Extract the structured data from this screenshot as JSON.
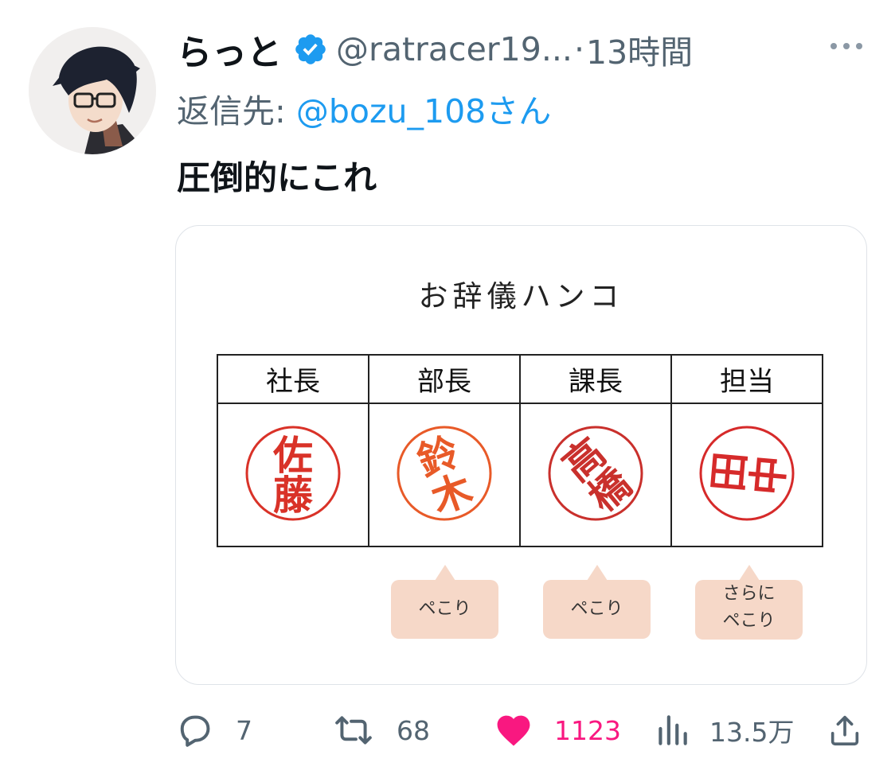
{
  "tweet": {
    "author_name": "らっと",
    "handle": "@ratracer19...",
    "separator": "·",
    "time": "13時間",
    "reply_label": "返信先:",
    "reply_mention": "@bozu_108さん",
    "text": "圧倒的にこれ"
  },
  "image": {
    "title": "お辞儀ハンコ",
    "columns": [
      "社長",
      "部長",
      "課長",
      "担当"
    ],
    "stamps": [
      {
        "name": "佐藤",
        "color": "#d93228",
        "tilt": 0
      },
      {
        "name": "鈴木",
        "color": "#e85a28",
        "tilt": -20
      },
      {
        "name": "高橋",
        "color": "#c9302c",
        "tilt": -40
      },
      {
        "name": "田中",
        "color": "#d62a2a",
        "tilt": -85
      }
    ],
    "notes": [
      "ペこり",
      "ペこり",
      "さらに\nペこり"
    ]
  },
  "actions": {
    "replies": "7",
    "retweets": "68",
    "likes": "1123",
    "views": "13.5万"
  },
  "colors": {
    "text": "#0f1419",
    "secondary": "#536471",
    "accent": "#1d9bf0",
    "like": "#f91880",
    "note_bg": "#f6d8c8"
  }
}
